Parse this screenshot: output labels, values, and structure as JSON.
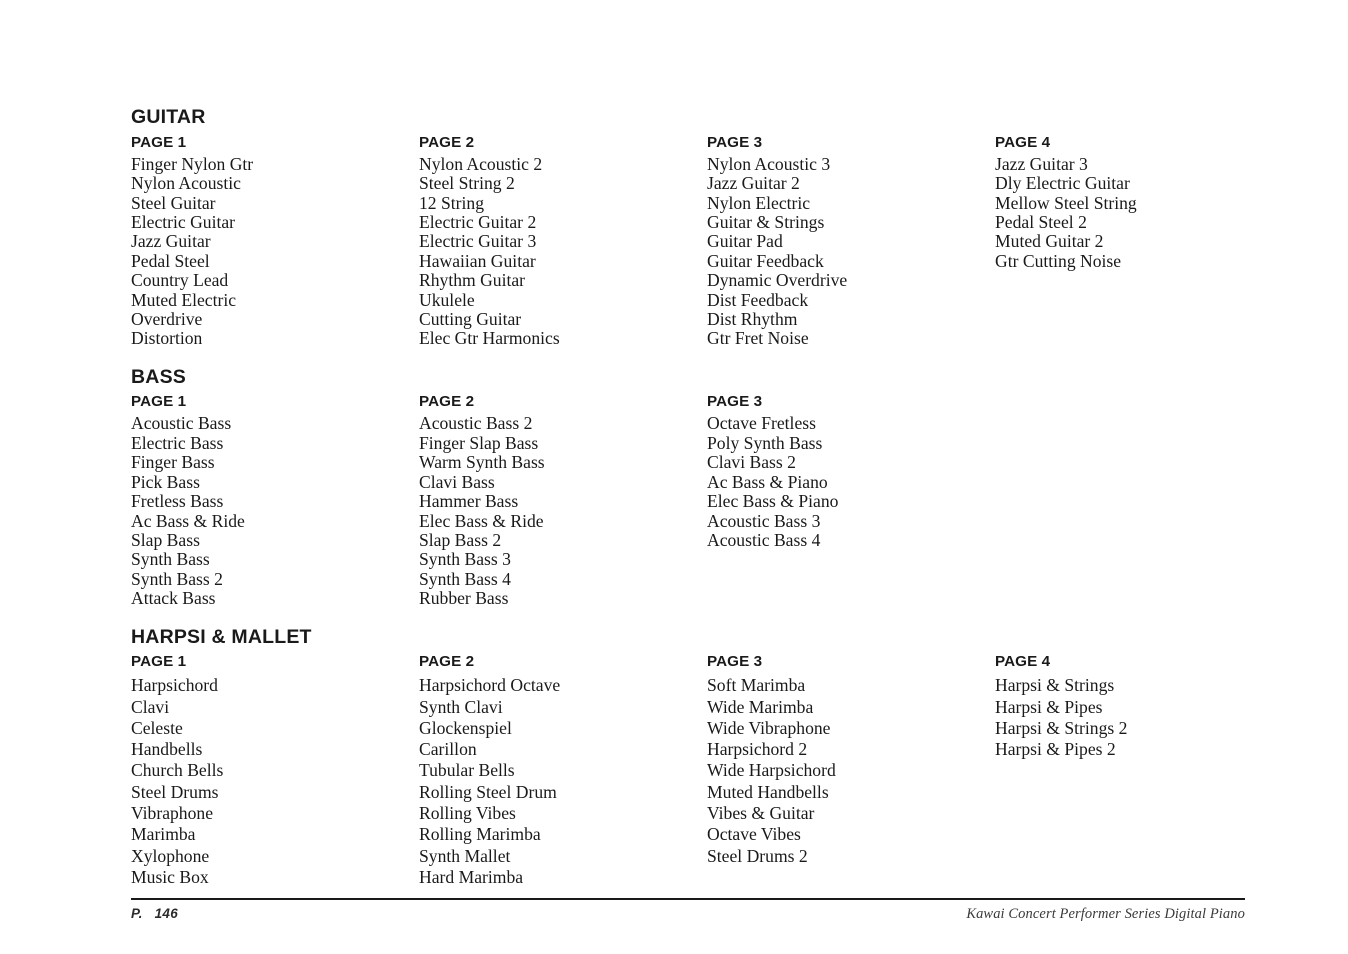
{
  "document": {
    "title": "Kawai Concert Performer Series Digital Piano",
    "page_number": "146",
    "page_prefix": "P."
  },
  "sections": [
    {
      "name": "GUITAR",
      "columns": [
        {
          "page_label": "PAGE 1",
          "items": [
            "Finger Nylon Gtr",
            "Nylon Acoustic",
            "Steel Guitar",
            "Electric Guitar",
            "Jazz Guitar",
            "Pedal Steel",
            "Country Lead",
            "Muted Electric",
            "Overdrive",
            "Distortion"
          ]
        },
        {
          "page_label": "PAGE 2",
          "items": [
            "Nylon Acoustic 2",
            "Steel String 2",
            "12 String",
            "Electric Guitar 2",
            "Electric Guitar 3",
            "Hawaiian Guitar",
            "Rhythm Guitar",
            "Ukulele",
            "Cutting Guitar",
            "Elec Gtr Harmonics"
          ]
        },
        {
          "page_label": "PAGE 3",
          "items": [
            "Nylon Acoustic 3",
            "Jazz Guitar 2",
            "Nylon Electric",
            "Guitar & Strings",
            "Guitar Pad",
            "Guitar Feedback",
            "Dynamic Overdrive",
            "Dist Feedback",
            "Dist Rhythm",
            "Gtr Fret Noise"
          ]
        },
        {
          "page_label": "PAGE 4",
          "items": [
            "Jazz Guitar 3",
            "Dly Electric Guitar",
            "Mellow Steel String",
            "Pedal Steel 2",
            "Muted Guitar 2",
            "Gtr Cutting Noise"
          ]
        }
      ]
    },
    {
      "name": "BASS",
      "columns": [
        {
          "page_label": "PAGE 1",
          "items": [
            "Acoustic Bass",
            "Electric Bass",
            "Finger Bass",
            "Pick Bass",
            "Fretless Bass",
            "Ac Bass & Ride",
            "Slap Bass",
            "Synth Bass",
            "Synth Bass 2",
            "Attack Bass"
          ]
        },
        {
          "page_label": "PAGE 2",
          "items": [
            "Acoustic Bass 2",
            "Finger Slap Bass",
            "Warm Synth Bass",
            "Clavi Bass",
            "Hammer Bass",
            "Elec Bass & Ride",
            "Slap Bass 2",
            "Synth Bass 3",
            "Synth Bass 4",
            "Rubber Bass"
          ]
        },
        {
          "page_label": "PAGE 3",
          "items": [
            "Octave Fretless",
            "Poly Synth Bass",
            "Clavi Bass 2",
            "Ac Bass & Piano",
            "Elec Bass & Piano",
            "Acoustic Bass 3",
            "Acoustic Bass 4"
          ]
        },
        {
          "page_label": "",
          "items": []
        }
      ]
    },
    {
      "name": "HARPSI & MALLET",
      "columns": [
        {
          "page_label": "PAGE 1",
          "items": [
            "Harpsichord",
            "Clavi",
            "Celeste",
            "Handbells",
            "Church Bells",
            "Steel Drums",
            "Vibraphone",
            "Marimba",
            "Xylophone",
            "Music Box"
          ]
        },
        {
          "page_label": "PAGE 2",
          "items": [
            "Harpsichord Octave",
            "Synth Clavi",
            "Glockenspiel",
            "Carillon",
            "Tubular Bells",
            "Rolling Steel Drum",
            "Rolling Vibes",
            "Rolling Marimba",
            "Synth Mallet",
            "Hard Marimba"
          ]
        },
        {
          "page_label": "PAGE 3",
          "items": [
            "Soft Marimba",
            "Wide Marimba",
            "Wide Vibraphone",
            "Harpsichord 2",
            "Wide Harpsichord",
            "Muted Handbells",
            "Vibes & Guitar",
            "Octave Vibes",
            "Steel Drums 2"
          ]
        },
        {
          "page_label": "PAGE 4",
          "items": [
            "Harpsi & Strings",
            "Harpsi & Pipes",
            "Harpsi & Strings 2",
            "Harpsi & Pipes 2"
          ]
        }
      ]
    }
  ]
}
